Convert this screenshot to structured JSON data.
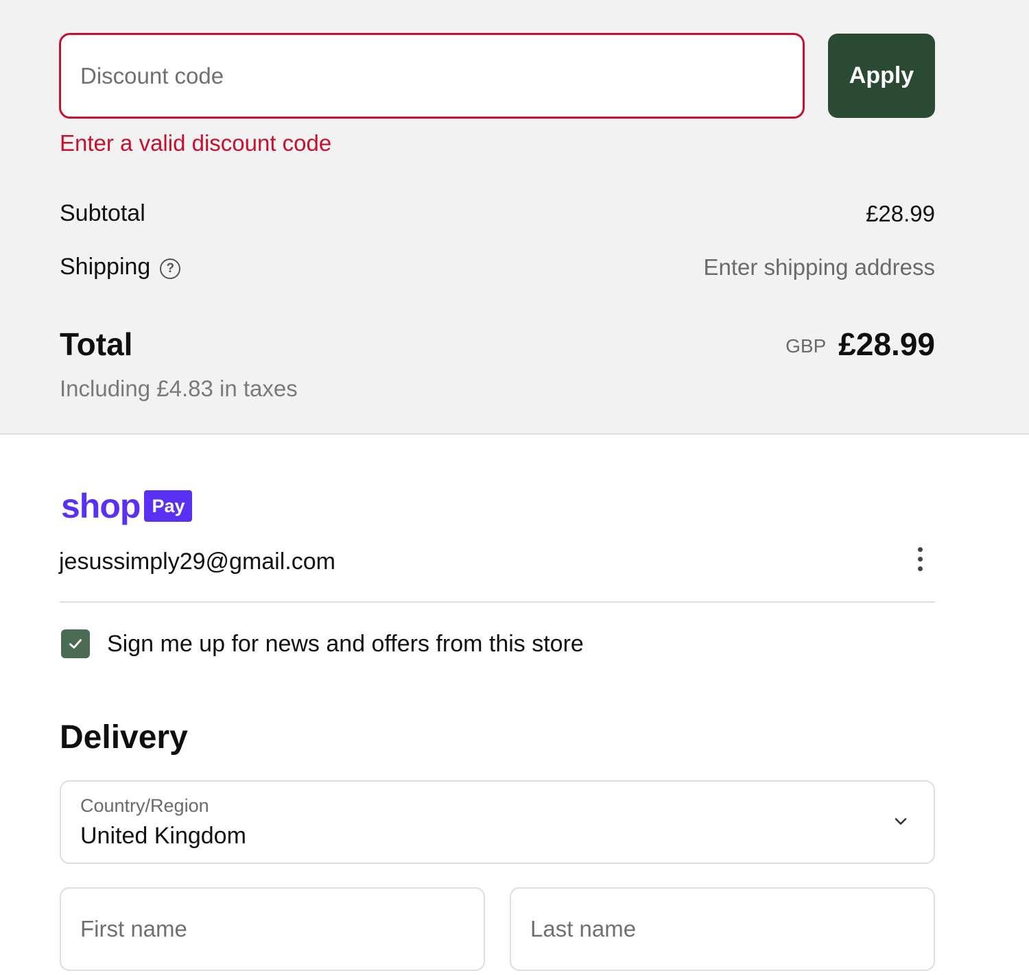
{
  "discount": {
    "placeholder": "Discount code",
    "value": "",
    "apply_label": "Apply",
    "error": "Enter a valid discount code"
  },
  "summary": {
    "subtotal_label": "Subtotal",
    "subtotal_value": "£28.99",
    "shipping_label": "Shipping",
    "shipping_help_icon": "question-circle-icon",
    "shipping_value": "Enter shipping address",
    "total_label": "Total",
    "currency": "GBP",
    "total_value": "£28.99",
    "taxes_note": "Including £4.83 in taxes"
  },
  "shop_pay": {
    "logo_word": "shop",
    "badge": "Pay",
    "email": "jesussimply29@gmail.com",
    "menu_icon": "more-vertical-icon"
  },
  "newsletter": {
    "checked": true,
    "label": "Sign me up for news and offers from this store"
  },
  "delivery": {
    "title": "Delivery",
    "country_label": "Country/Region",
    "country_value": "United Kingdom",
    "first_name_placeholder": "First name",
    "last_name_placeholder": "Last name"
  },
  "colors": {
    "error": "#c8102e",
    "apply_button": "#2a4a34",
    "shop_pay": "#5a31f4",
    "checkbox": "#4b6b55",
    "summary_background": "#f2f2f2"
  }
}
